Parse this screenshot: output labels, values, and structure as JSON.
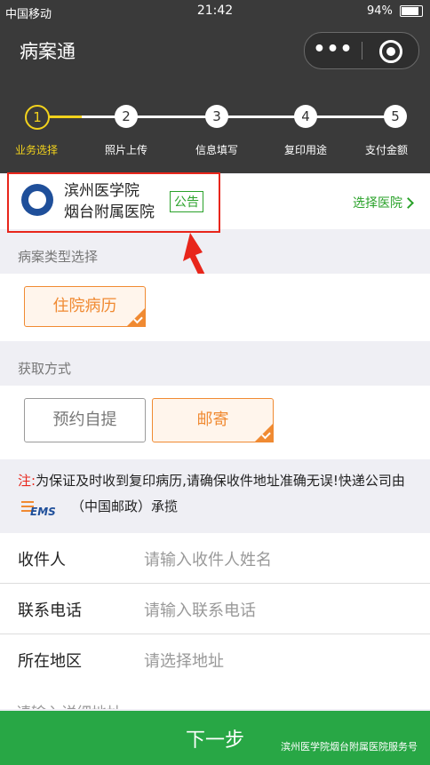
{
  "status_bar": {
    "carrier": "中国移动",
    "time": "21:42",
    "battery": "94%"
  },
  "header": {
    "title": "病案通",
    "more_label": "•••"
  },
  "steps": [
    {
      "num": "1",
      "label": "业务选择",
      "active": true
    },
    {
      "num": "2",
      "label": "照片上传",
      "active": false
    },
    {
      "num": "3",
      "label": "信息填写",
      "active": false
    },
    {
      "num": "4",
      "label": "复印用途",
      "active": false
    },
    {
      "num": "5",
      "label": "支付金额",
      "active": false
    }
  ],
  "hospital": {
    "name_line1": "滨州医学院",
    "name_line2": "烟台附属医院",
    "notice": "公告",
    "choose": "选择医院"
  },
  "record_type": {
    "title": "病案类型选择",
    "option": "住院病历"
  },
  "pickup": {
    "title": "获取方式",
    "option1": "预约自提",
    "option2": "邮寄"
  },
  "note": {
    "prefix": "注:",
    "text": "为保证及时收到复印病历,请确保收件地址准确无误!快递公司由",
    "ems": "EMS",
    "suffix": "（中国邮政）承揽"
  },
  "form": {
    "recipient_label": "收件人",
    "recipient_placeholder": "请输入收件人姓名",
    "phone_label": "联系电话",
    "phone_placeholder": "请输入联系电话",
    "region_label": "所在地区",
    "region_placeholder": "请选择地址",
    "detail_placeholder": "请输入详细地址"
  },
  "footer": {
    "next": "下一步",
    "watermark": "滨州医学院烟台附属医院服务号"
  },
  "colors": {
    "accent": "#28a745",
    "orange": "#f08a32",
    "yellow": "#f2d21c",
    "red": "#e8261b"
  }
}
